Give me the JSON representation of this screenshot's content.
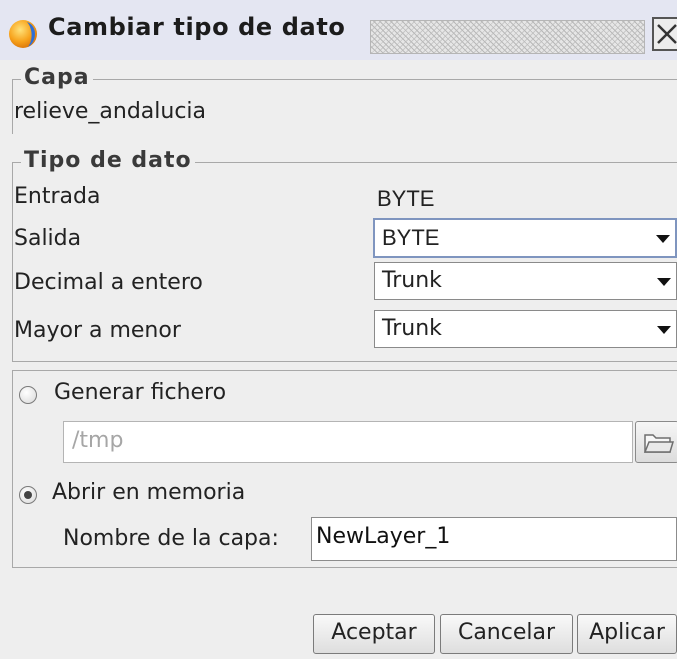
{
  "window": {
    "title": "Cambiar tipo de dato"
  },
  "capa": {
    "legend": "Capa",
    "layer_name": "relieve_andalucia"
  },
  "tipo_dato": {
    "legend": "Tipo de dato",
    "entrada_label": "Entrada",
    "entrada_value": "BYTE",
    "salida_label": "Salida",
    "salida_value": "BYTE",
    "decimal_label": "Decimal a entero",
    "decimal_value": "Trunk",
    "mayor_label": "Mayor a menor",
    "mayor_value": "Trunk"
  },
  "output": {
    "generar_label": "Generar fichero",
    "generar_selected": false,
    "path_value": "/tmp",
    "memoria_label": "Abrir en memoria",
    "memoria_selected": true,
    "nombre_label": "Nombre de la capa:",
    "nombre_value": "NewLayer_1"
  },
  "buttons": {
    "aceptar": "Aceptar",
    "cancelar": "Cancelar",
    "aplicar": "Aplicar"
  },
  "icons": {
    "app": "sextante-app-icon",
    "close": "close-icon",
    "folder": "folder-icon"
  }
}
